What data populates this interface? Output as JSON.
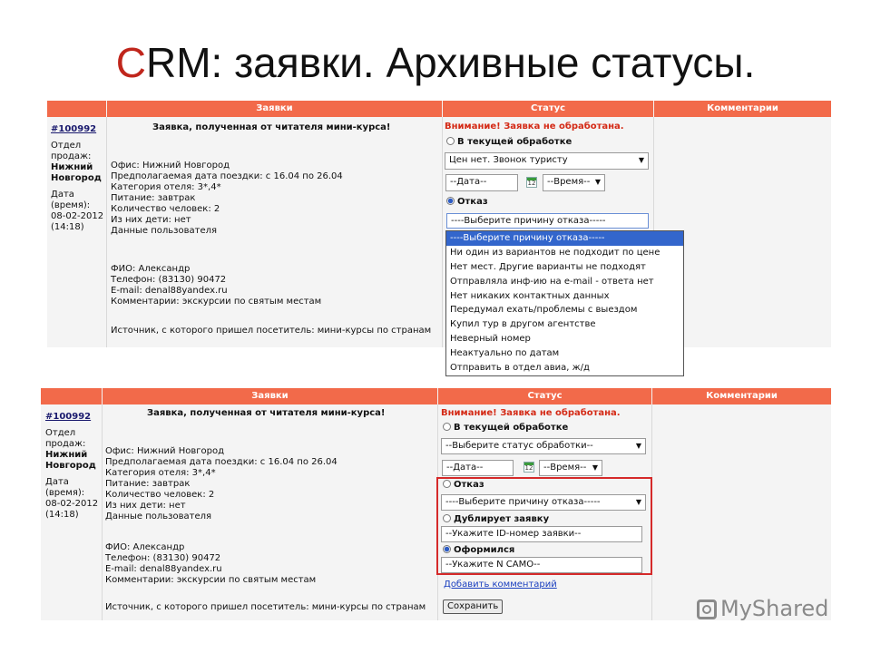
{
  "slide": {
    "title_first": "C",
    "title_rest": "RM: заявки. Архивные статусы."
  },
  "headers": {
    "requests": "Заявки",
    "status": "Статус",
    "comments": "Комментарии"
  },
  "request": {
    "id": "#100992",
    "dept_label_1": "Отдел",
    "dept_label_2": "продаж:",
    "dept_value_1": "Нижний",
    "dept_value_2": "Новгород",
    "date_label_1": "Дата",
    "date_label_2": "(время):",
    "date_value": "08-02-2012",
    "time_value": "(14:18)",
    "heading": "Заявка, полученная от читателя мини-курса!",
    "lines": [
      "Офис: Нижний Новгород",
      "Предполагаемая дата поездки: с 16.04 по 26.04",
      "Категория отеля: 3*,4*",
      "Питание: завтрак",
      "Количество человек: 2",
      "Из них дети: нет",
      "Данные пользователя"
    ],
    "contact_lines": [
      "ФИО: Александр",
      "Телефон: (83130) 90472",
      "E-mail: denal88yandex.ru",
      "Комментарии: экскурсии по святым местам"
    ],
    "source": "Источник, с которого пришел посетитель: мини-курсы по странам"
  },
  "status": {
    "warning": "Внимание! Заявка не обработана.",
    "in_progress_label": "В текущей обработке",
    "in_progress_value_top": "Цен нет. Звонок туристу",
    "in_progress_value_bottom": "--Выберите статус обработки--",
    "date_placeholder": "--Дата--",
    "calendar_num": "12",
    "time_placeholder": "--Время--",
    "refusal_label": "Отказ",
    "refusal_placeholder": "----Выберите причину отказа-----",
    "duplicate_label": "Дублирует заявку",
    "duplicate_placeholder": "--Укажите ID-номер заявки--",
    "formalized_label": "Оформился",
    "formalized_placeholder": "--Укажите N САМО--",
    "add_comment": "Добавить комментарий",
    "save": "Сохранить"
  },
  "refusal_options": [
    "----Выберите причину отказа-----",
    "Ни один из вариантов не подходит по цене",
    "Нет мест. Другие варианты не подходят",
    "Отправляла инф-ию на e-mail - ответа нет",
    "Нет никаких контактных данных",
    "Передумал ехать/проблемы с выездом",
    "Купил тур в другом агентстве",
    "Неверный номер",
    "Неактуально по датам",
    "Отправить в отдел авиа, ж/д"
  ],
  "watermark": "MyShared"
}
